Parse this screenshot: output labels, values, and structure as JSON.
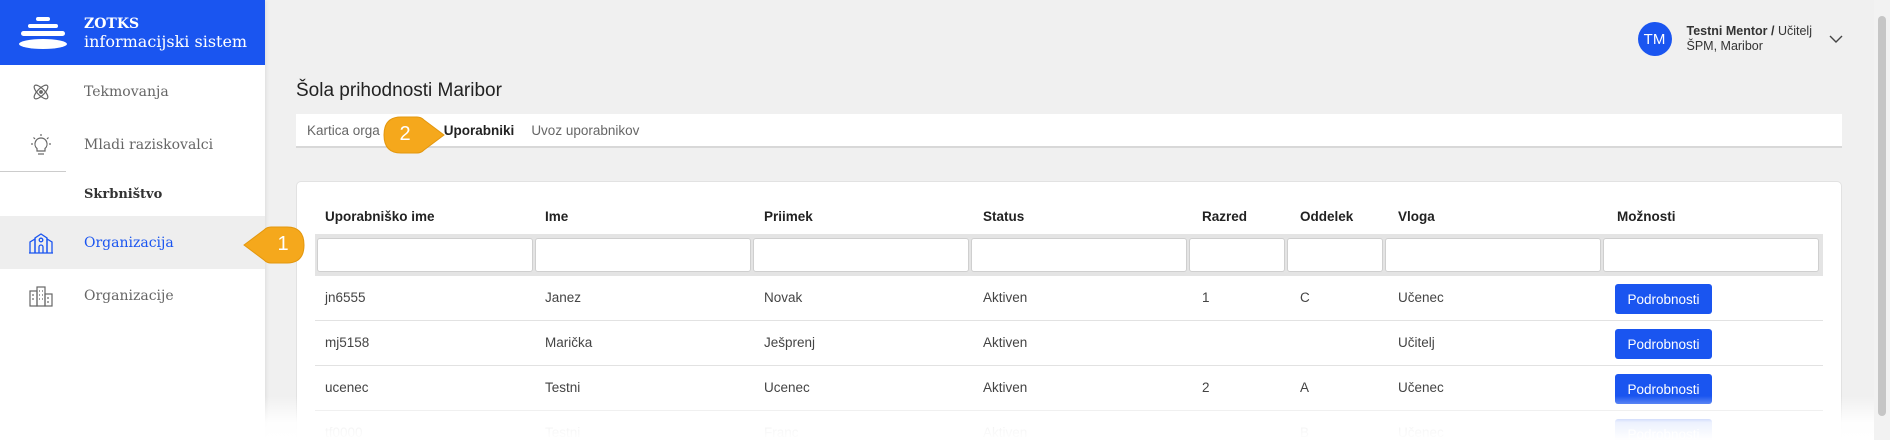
{
  "brand": {
    "title": "ZOTKS",
    "subtitle": "informacijski sistem"
  },
  "sidebar": {
    "items": [
      {
        "label": "Tekmovanja",
        "icon": "atom-icon"
      },
      {
        "label": "Mladi raziskovalci",
        "icon": "lightbulb-icon"
      }
    ],
    "section": "Skrbništvo",
    "section_items": [
      {
        "label": "Organizacija",
        "icon": "school-icon",
        "active": true
      },
      {
        "label": "Organizacije",
        "icon": "buildings-icon"
      }
    ]
  },
  "user": {
    "initials": "TM",
    "name": "Testni Mentor",
    "separator": " / ",
    "role": "Učitelj",
    "org": "ŠPM, Maribor"
  },
  "page": {
    "title": "Šola prihodnosti Maribor"
  },
  "tabs": [
    "Kartica orga",
    "Uporabniki",
    "Uvoz uporabnikov"
  ],
  "table": {
    "columns": [
      "Uporabniško ime",
      "Ime",
      "Priimek",
      "Status",
      "Razred",
      "Oddelek",
      "Vloga",
      "Možnosti"
    ],
    "rows": [
      [
        "jn6555",
        "Janez",
        "Novak",
        "Aktiven",
        "1",
        "C",
        "Učenec"
      ],
      [
        "mj5158",
        "Marička",
        "Ješprenj",
        "Aktiven",
        "",
        "",
        "Učitelj"
      ],
      [
        "ucenec",
        "Testni",
        "Ucenec",
        "Aktiven",
        "2",
        "A",
        "Učenec"
      ],
      [
        "tf0000",
        "Testni",
        "Franc",
        "Aktiven",
        "",
        "B",
        "Učenec"
      ]
    ],
    "action_label": "Podrobnosti"
  },
  "callouts": [
    "1",
    "2"
  ],
  "colors": {
    "accent": "#1a55f0",
    "callout": "#f5a81c",
    "background": "#f0f0f0"
  }
}
